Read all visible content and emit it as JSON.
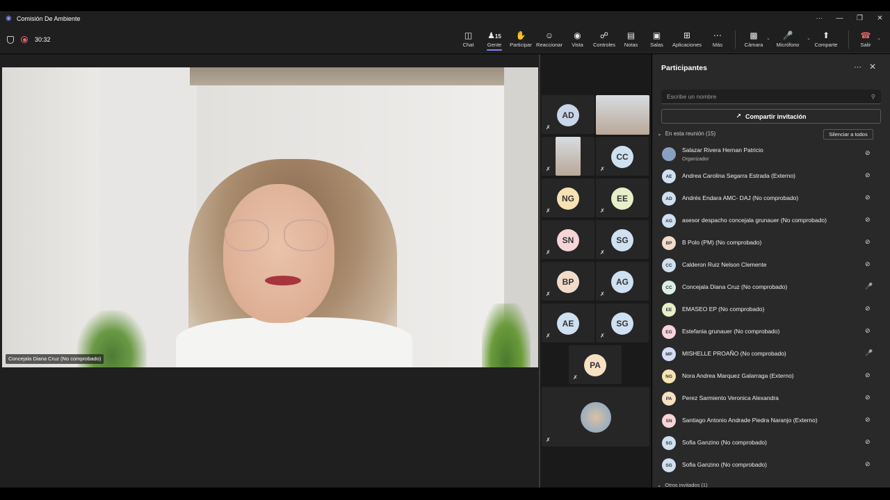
{
  "window": {
    "title": "Comisión De Ambiente",
    "controls": [
      "···",
      "—",
      "❐",
      "✕"
    ]
  },
  "meeting": {
    "timer": "30:32"
  },
  "toolbar": {
    "items": [
      {
        "label": "Chat",
        "icon": "chat-icon"
      },
      {
        "label": "Gente",
        "icon": "people-icon",
        "count": "15",
        "active": true
      },
      {
        "label": "Participar",
        "icon": "raise-hand-icon"
      },
      {
        "label": "Reaccionar",
        "icon": "smile-icon"
      },
      {
        "label": "Vista",
        "icon": "view-icon"
      },
      {
        "label": "Controles",
        "icon": "shield-icon"
      },
      {
        "label": "Notas",
        "icon": "notes-icon"
      },
      {
        "label": "Salas",
        "icon": "rooms-icon"
      },
      {
        "label": "Aplicaciones",
        "icon": "add-icon"
      },
      {
        "label": "Más",
        "icon": "more-icon"
      }
    ],
    "camera_label": "Cámara",
    "mic_label": "Micrófono",
    "share_label": "Comparte",
    "leave_label": "Salir"
  },
  "main_video": {
    "name_tag": "Concejala Diana Cruz (No comprobado)"
  },
  "gallery": {
    "tiles": [
      "AD",
      "",
      "",
      "CC",
      "NG",
      "EE",
      "SN",
      "SG",
      "BP",
      "AG",
      "AE",
      "SG",
      "PA",
      ""
    ]
  },
  "colors": {
    "AD": "#c9d6e8",
    "CC": "#cfe0f0",
    "NG": "#f6e3b4",
    "EE": "#e6efc9",
    "SN": "#f7d4d6",
    "SG": "#cfe0f0",
    "BP": "#f1dccc",
    "AG": "#cfe0f0",
    "AE": "#cfe0f0",
    "PA": "#f7e0c3",
    "EG": "#f7d4dc",
    "MP": "#d6dcf5",
    "accent": "#7f85f5"
  },
  "panel": {
    "title": "Participantes",
    "search_placeholder": "Escribe un nombre",
    "invite_label": "Compartir invitación",
    "section_label": "En esta reunión (15)",
    "mute_all_label": "Silenciar a todos",
    "other_label": "Otros invitados (1)",
    "participants": [
      {
        "initials": "",
        "name": "Salazar Rivera Hernan Patricio",
        "role": "Organizador",
        "color": "#8aa0c0",
        "mic": "muted"
      },
      {
        "initials": "AE",
        "name": "Andrea Carolina Segarra Estrada (Externo)",
        "color": "#cfe0f0",
        "mic": "muted"
      },
      {
        "initials": "AD",
        "name": "Andrés Endara AMC- DAJ (No comprobado)",
        "color": "#cfe0f0",
        "mic": "muted"
      },
      {
        "initials": "AG",
        "name": "asesor despacho concejala grunauer (No comprobado)",
        "color": "#cfe0f0",
        "mic": "muted"
      },
      {
        "initials": "BP",
        "name": "B Polo (PM) (No comprobado)",
        "color": "#f1dccc",
        "mic": "muted"
      },
      {
        "initials": "CC",
        "name": "Calderon Ruiz Nelson Clemente",
        "color": "#cfe0f0",
        "mic": "muted"
      },
      {
        "initials": "CC",
        "name": "Concejala Diana Cruz (No comprobado)",
        "color": "#d9efe3",
        "mic": "on"
      },
      {
        "initials": "EE",
        "name": "EMASEO EP (No comprobado)",
        "color": "#e6efc9",
        "mic": "muted"
      },
      {
        "initials": "EG",
        "name": "Estefania grunauer (No comprobado)",
        "color": "#f7d4dc",
        "mic": "muted"
      },
      {
        "initials": "MP",
        "name": "MISHELLE PROAÑO (No comprobado)",
        "color": "#d6dcf5",
        "mic": "on"
      },
      {
        "initials": "NG",
        "name": "Nora Andrea Marquez Galarraga (Externo)",
        "color": "#f6e3b4",
        "mic": "muted"
      },
      {
        "initials": "PA",
        "name": "Perez Sarmiento Veronica Alexandra",
        "color": "#f7e0c3",
        "mic": "muted"
      },
      {
        "initials": "SN",
        "name": "Santiago Antonio Andrade Piedra Naranjo (Externo)",
        "color": "#f7d4d6",
        "mic": "muted"
      },
      {
        "initials": "SG",
        "name": "Sofia Ganzino (No comprobado)",
        "color": "#cfe0f0",
        "mic": "muted"
      },
      {
        "initials": "SG",
        "name": "Sofia Ganzino (No comprobado)",
        "color": "#cfe0f0",
        "mic": "muted"
      }
    ]
  }
}
